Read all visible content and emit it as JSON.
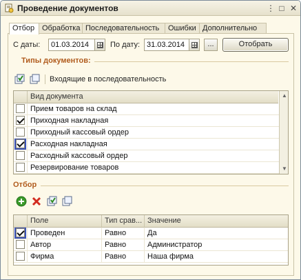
{
  "window": {
    "title": "Проведение документов",
    "title_buttons": {
      "menu": "⋮",
      "maximize": "□",
      "close": "✕"
    }
  },
  "tabs": [
    {
      "label": "Отбор",
      "active": true
    },
    {
      "label": "Обработка",
      "active": false
    },
    {
      "label": "Последовательность",
      "active": false
    },
    {
      "label": "Ошибки",
      "active": false
    },
    {
      "label": "Дополнительно",
      "active": false
    }
  ],
  "period": {
    "from_label": "С даты:",
    "from_value": "01.03.2014",
    "to_label": "По дату:",
    "to_value": "31.03.2014",
    "dots_label": "...",
    "filter_button": "Отобрать"
  },
  "doc_types": {
    "section_title": "Типы документов:",
    "toolbar_text": "Входящие в последовательность",
    "column_header": "Вид документа",
    "rows": [
      {
        "label": "Прием товаров на склад",
        "checked": false
      },
      {
        "label": "Приходная накладная",
        "checked": true
      },
      {
        "label": "Приходный кассовый ордер",
        "checked": false
      },
      {
        "label": "Расходная накладная",
        "checked": true
      },
      {
        "label": "Расходный кассовый ордер",
        "checked": false
      },
      {
        "label": "Резервирование товаров",
        "checked": false
      }
    ]
  },
  "filter": {
    "section_title": "Отбор",
    "headers": {
      "field": "Поле",
      "compare": "Тип срав...",
      "value": "Значение"
    },
    "rows": [
      {
        "checked": true,
        "field": "Проведен",
        "compare": "Равно",
        "value": "Да"
      },
      {
        "checked": false,
        "field": "Автор",
        "compare": "Равно",
        "value": "Администратор"
      },
      {
        "checked": false,
        "field": "Фирма",
        "compare": "Равно",
        "value": "Наша фирма"
      }
    ]
  },
  "colors": {
    "accent_orange": "#b15c1e",
    "window_bg": "#fdf9e9",
    "focus_blue": "#3b53b8",
    "add_green": "#3a9a2a",
    "delete_red": "#d22b1f"
  },
  "icons": {
    "check_all": "check-all-icon",
    "uncheck_all": "uncheck-all-icon",
    "add": "add-icon",
    "delete": "delete-icon"
  }
}
